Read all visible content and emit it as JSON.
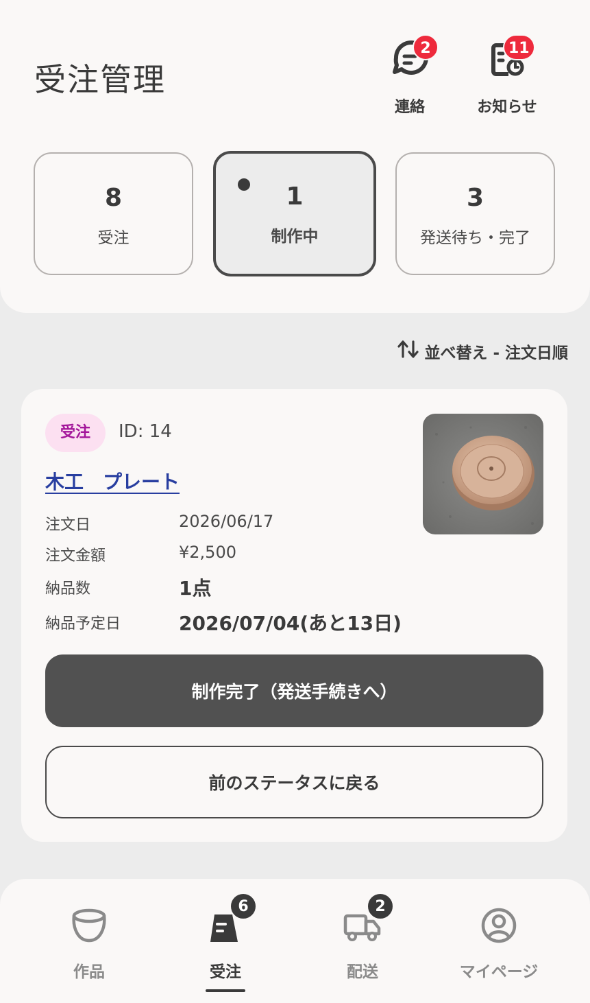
{
  "header": {
    "title": "受注管理",
    "actions": [
      {
        "label": "連絡",
        "icon": "chat-icon",
        "badge": "2"
      },
      {
        "label": "お知らせ",
        "icon": "notice-icon",
        "badge": "11"
      }
    ]
  },
  "status_tabs": [
    {
      "count": "8",
      "label": "受注"
    },
    {
      "count": "1",
      "label": "制作中"
    },
    {
      "count": "3",
      "label": "発送待ち・完了"
    }
  ],
  "sort": {
    "label": "並べ替え - 注文日順",
    "icon": "sort-arrows-icon"
  },
  "order": {
    "status": "受注",
    "id": "ID: 14",
    "product_name": "木工　プレート",
    "fields": [
      {
        "label": "注文日",
        "value": "2026/06/17"
      },
      {
        "label": "注文金額",
        "value": "¥2,500"
      },
      {
        "label": "納品数",
        "value": "1点"
      },
      {
        "label": "納品予定日",
        "value": "2026/07/04(あと13日)"
      }
    ],
    "primary_button": "制作完了（発送手続きへ）",
    "secondary_button": "前のステータスに戻る"
  },
  "bottom_nav": [
    {
      "label": "作品",
      "icon": "pot-icon",
      "badge": ""
    },
    {
      "label": "受注",
      "icon": "order-icon",
      "badge": "6"
    },
    {
      "label": "配送",
      "icon": "truck-icon",
      "badge": "2"
    },
    {
      "label": "マイページ",
      "icon": "user-icon",
      "badge": ""
    }
  ],
  "colors": {
    "accent": "#515151",
    "badge_red": "#ee2a3c",
    "status_pill_bg": "#fce0f1",
    "status_pill_text": "#a3169a",
    "link": "#283ea0"
  }
}
